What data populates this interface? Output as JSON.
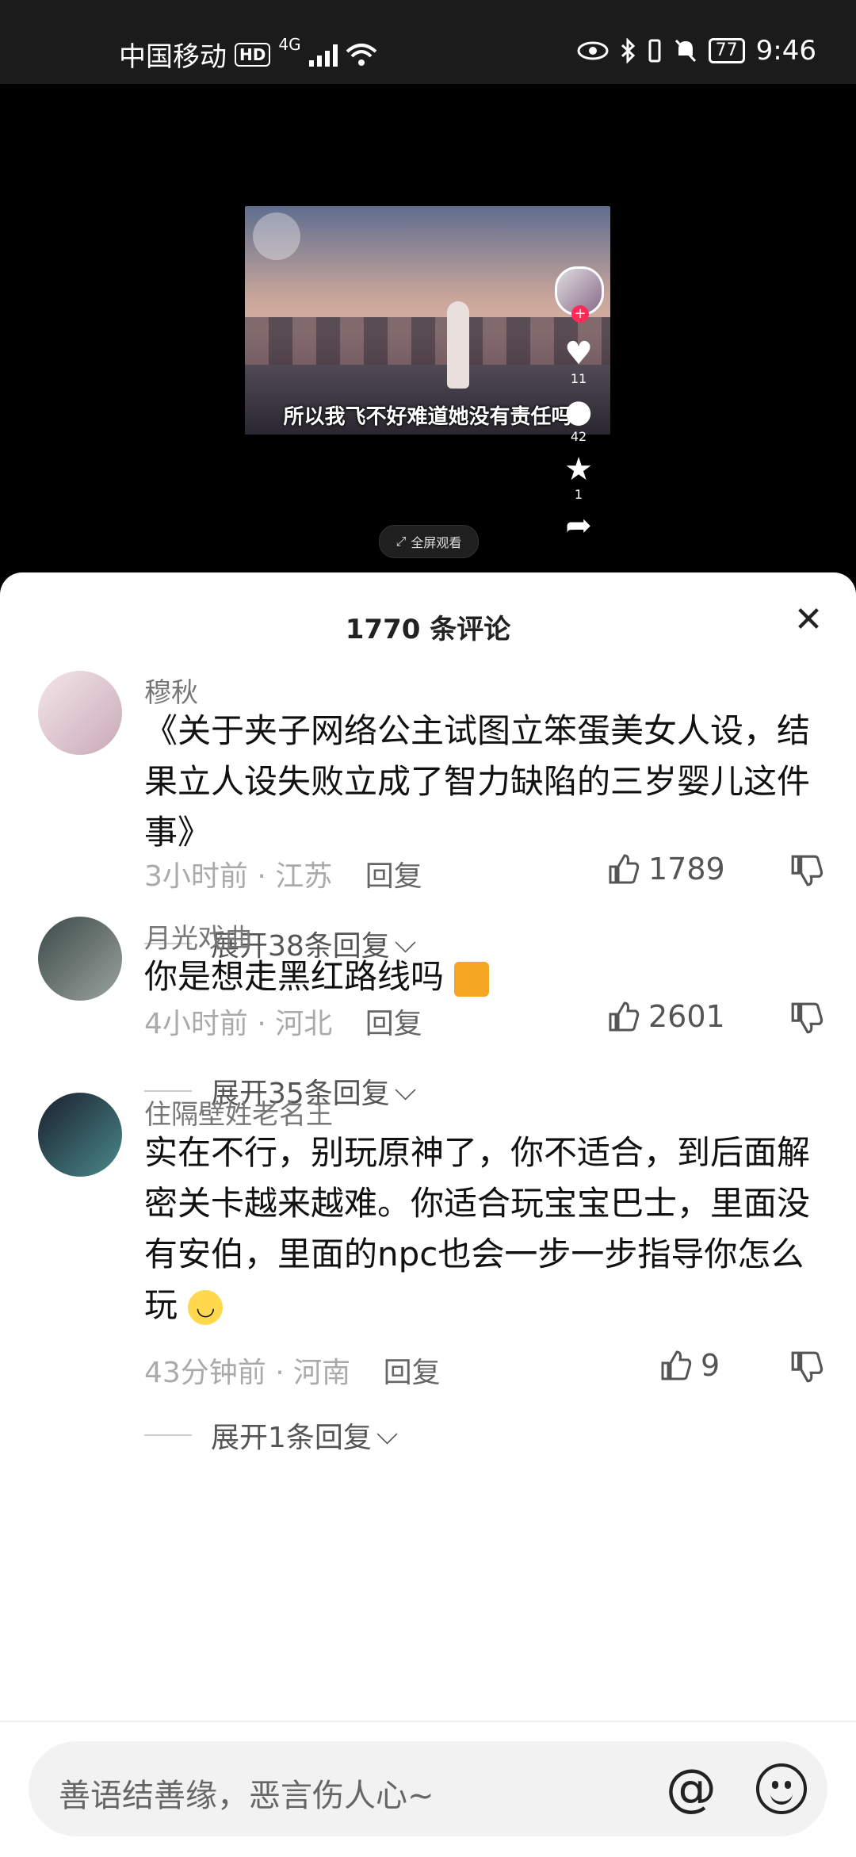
{
  "status_bar": {
    "carrier": "中国移动",
    "hd_badge": "HD",
    "network": "4G",
    "battery": "77",
    "time": "9:46"
  },
  "video": {
    "subtitle": "所以我飞不好难道她没有责任吗",
    "likes": "11",
    "comments": "42",
    "favorites": "1",
    "fullscreen_label": "全屏观看"
  },
  "sheet": {
    "title": "1770 条评论",
    "close_icon": "close-icon"
  },
  "comments": [
    {
      "user": "穆秋",
      "text": "《关于夹子网络公主试图立笨蛋美女人设，结果立人设失败立成了智力缺陷的三岁婴儿这件事》",
      "time": "3小时前",
      "location": "江苏",
      "reply": "回复",
      "likes": "1789",
      "expand": "展开38条回复"
    },
    {
      "user": "月光戏曲",
      "text": "你是想走黑红路线吗",
      "time": "4小时前",
      "location": "河北",
      "reply": "回复",
      "likes": "2601",
      "expand": "展开35条回复"
    },
    {
      "user": "住隔壁姓老名王",
      "text": "实在不行，别玩原神了，你不适合，到后面解密关卡越来越难。你适合玩宝宝巴士，里面没有安伯，里面的npc也会一步一步指导你怎么玩",
      "time": "43分钟前",
      "location": "河南",
      "reply": "回复",
      "likes": "9",
      "expand": "展开1条回复"
    }
  ],
  "input": {
    "placeholder": "善语结善缘，恶言伤人心~",
    "at": "@"
  }
}
